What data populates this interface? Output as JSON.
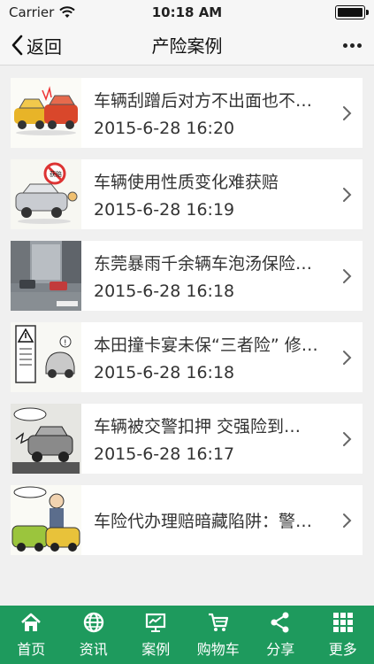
{
  "status_bar": {
    "carrier": "Carrier",
    "time": "10:18 AM"
  },
  "nav": {
    "back_label": "返回",
    "title": "产险案例"
  },
  "articles": [
    {
      "title": "车辆刮蹭后对方不出面也不…",
      "date": "2015-6-28 16:20",
      "thumb_icon": "car-crash-cartoon"
    },
    {
      "title": "车辆使用性质变化难获赔",
      "date": "2015-6-28 16:19",
      "thumb_icon": "no-compensation-cartoon"
    },
    {
      "title": "东莞暴雨千余辆车泡汤保险…",
      "date": "2015-6-28 16:18",
      "thumb_icon": "flooded-street-photo"
    },
    {
      "title": "本田撞卡宴未保“三者险” 修…",
      "date": "2015-6-28 16:18",
      "thumb_icon": "warning-sign-cartoon"
    },
    {
      "title": "车辆被交警扣押 交强险到…",
      "date": "2015-6-28 16:17",
      "thumb_icon": "seized-car-cartoon"
    },
    {
      "title": "车险代办理赔暗藏陷阱：警…",
      "date": "",
      "thumb_icon": "insurance-agent-cartoon"
    }
  ],
  "tabs": [
    {
      "label": "首页",
      "icon": "home-icon"
    },
    {
      "label": "资讯",
      "icon": "globe-icon"
    },
    {
      "label": "案例",
      "icon": "presentation-icon"
    },
    {
      "label": "购物车",
      "icon": "cart-icon"
    },
    {
      "label": "分享",
      "icon": "share-icon"
    },
    {
      "label": "更多",
      "icon": "grid-icon"
    }
  ],
  "colors": {
    "tab_bar": "#1e9a5d",
    "background": "#f0f0f0",
    "card": "#ffffff"
  }
}
